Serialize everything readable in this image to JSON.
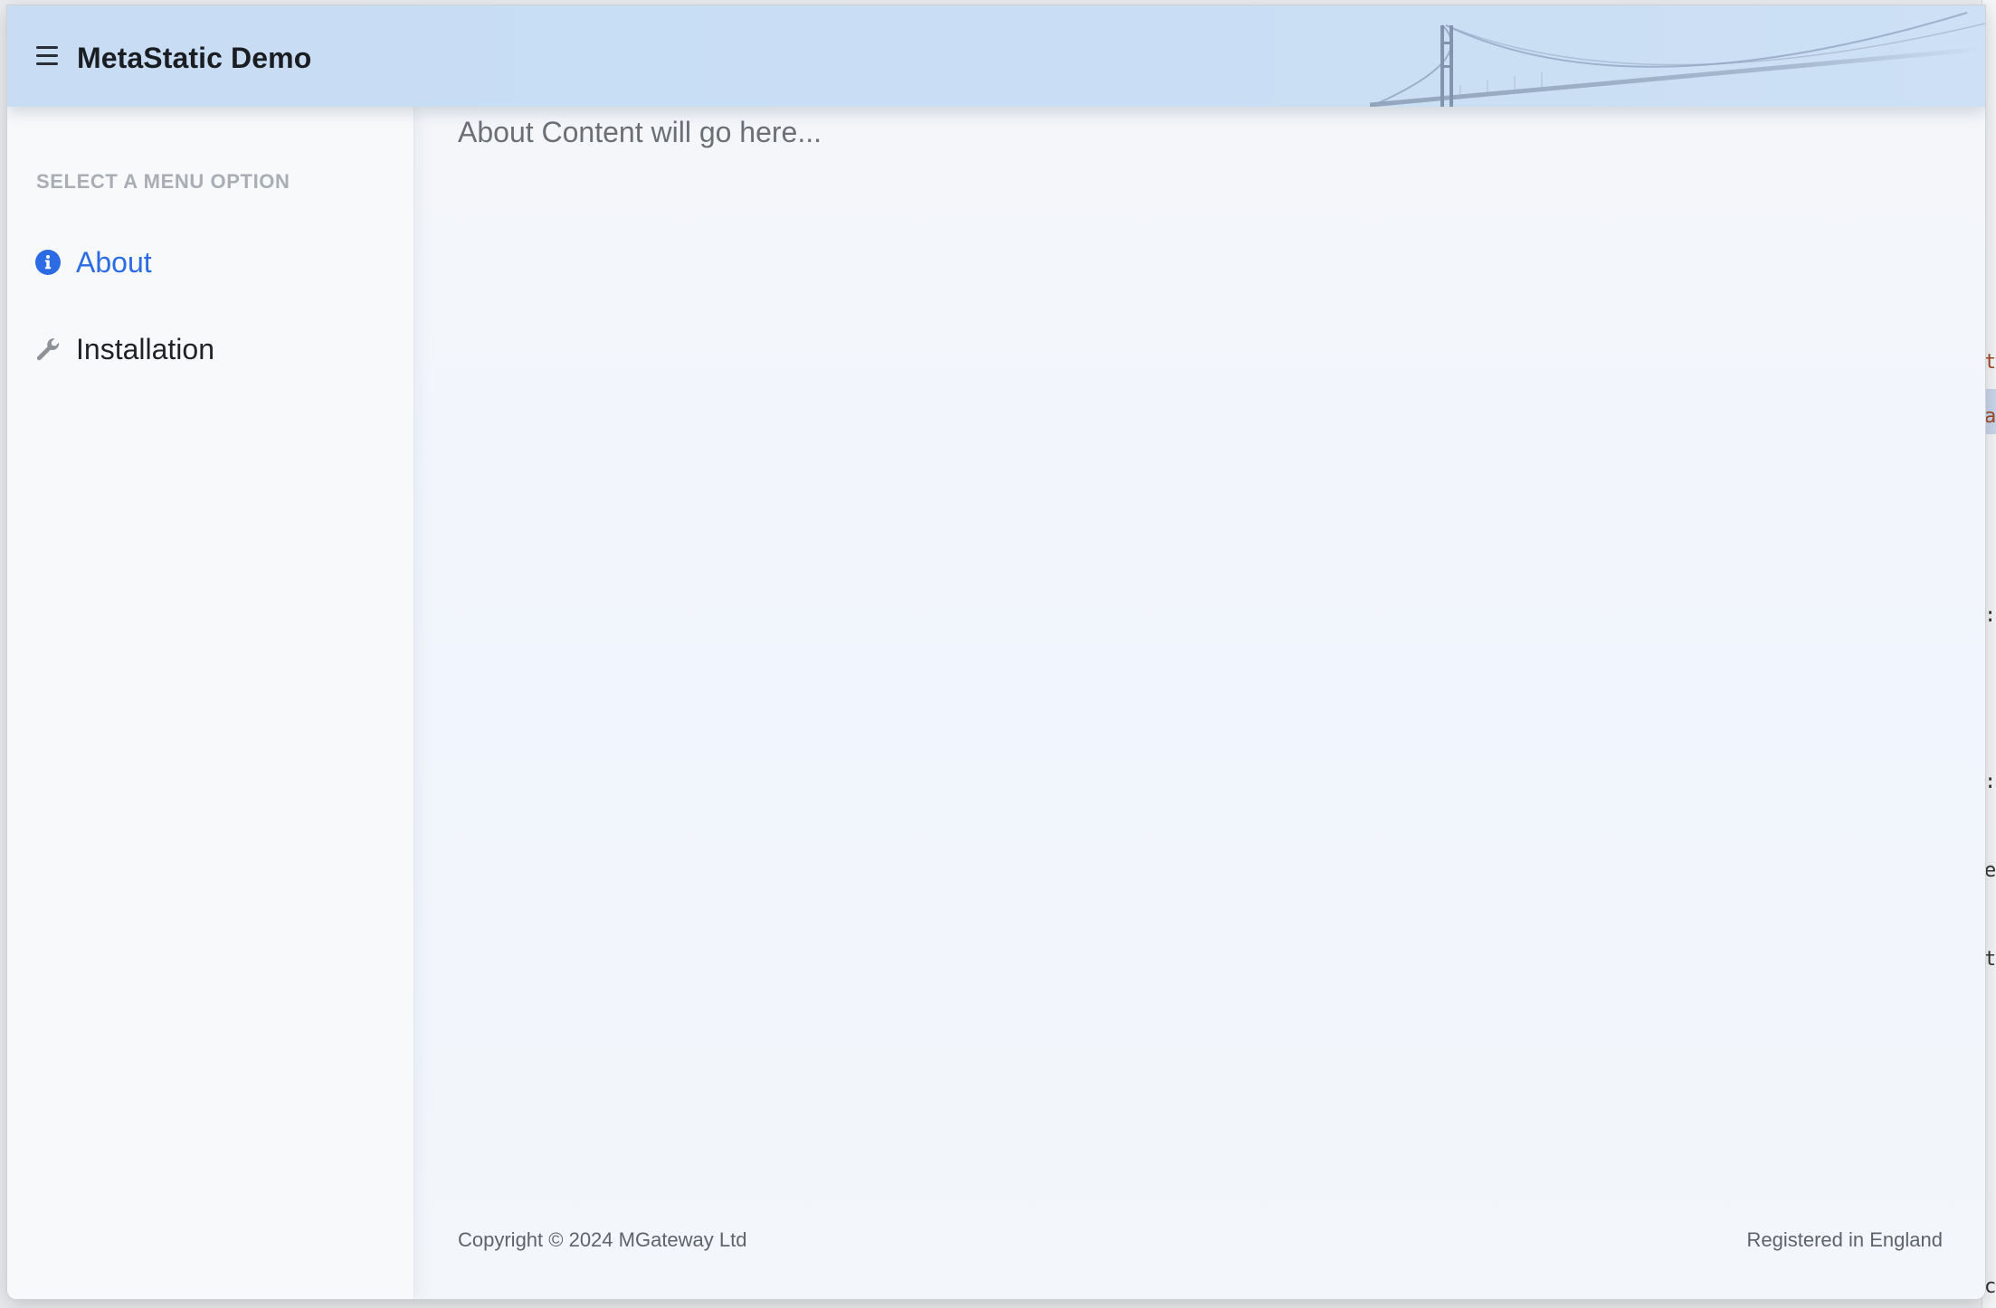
{
  "header": {
    "title": "MetaStatic Demo",
    "menu_icon": "hamburger-menu-icon",
    "decoration": "suspension-bridge-illustration",
    "background_color": "#c8ddf3"
  },
  "sidebar": {
    "heading": "SELECT A MENU OPTION",
    "items": [
      {
        "label": "About",
        "icon": "info-circle-icon",
        "active": true
      },
      {
        "label": "Installation",
        "icon": "wrench-icon",
        "active": false
      }
    ]
  },
  "main": {
    "content_text": "About Content will go here..."
  },
  "footer": {
    "left": "Copyright © 2024 MGateway Ltd",
    "right": "Registered in England"
  },
  "colors": {
    "accent": "#2d6be4",
    "heading_muted": "#a9adb4",
    "content_bg": "#f2f5fb",
    "sidebar_bg": "#f8f9fb"
  }
}
